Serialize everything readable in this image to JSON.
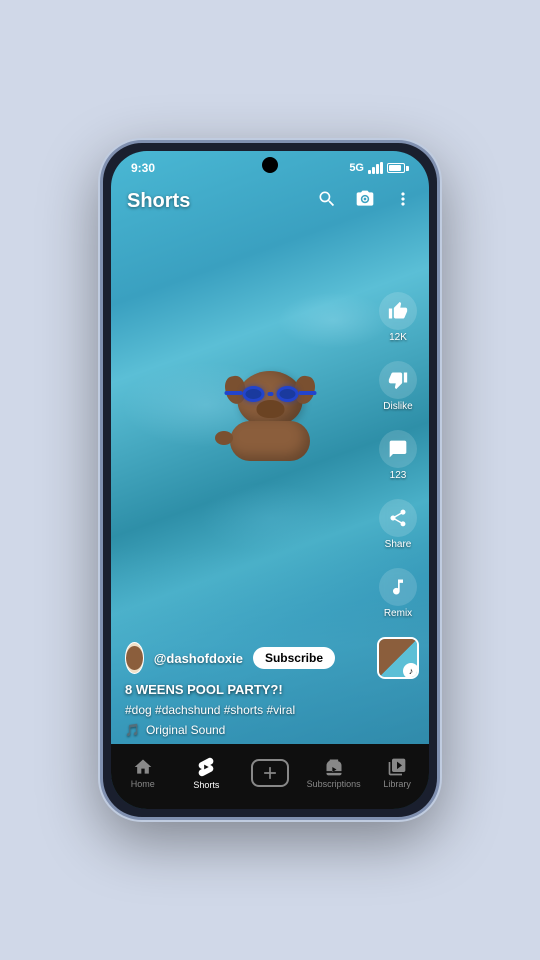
{
  "status_bar": {
    "time": "9:30",
    "network": "5G"
  },
  "header": {
    "title": "Shorts"
  },
  "video": {
    "description": "8 WEENS POOL PARTY?!",
    "tags": "#dog #dachshund #shorts #viral",
    "audio": "Original Sound"
  },
  "channel": {
    "name": "@dashofdoxie",
    "subscribe_label": "Subscribe"
  },
  "actions": {
    "like_count": "12K",
    "like_label": "Like",
    "dislike_label": "Dislike",
    "comment_count": "123",
    "share_label": "Share",
    "remix_label": "Remix"
  },
  "bottom_nav": {
    "items": [
      {
        "label": "Home",
        "icon": "home",
        "active": false
      },
      {
        "label": "Shorts",
        "icon": "shorts",
        "active": true
      },
      {
        "label": "",
        "icon": "add",
        "active": false
      },
      {
        "label": "Subscriptions",
        "icon": "subscriptions",
        "active": false
      },
      {
        "label": "Library",
        "icon": "library",
        "active": false
      }
    ]
  }
}
